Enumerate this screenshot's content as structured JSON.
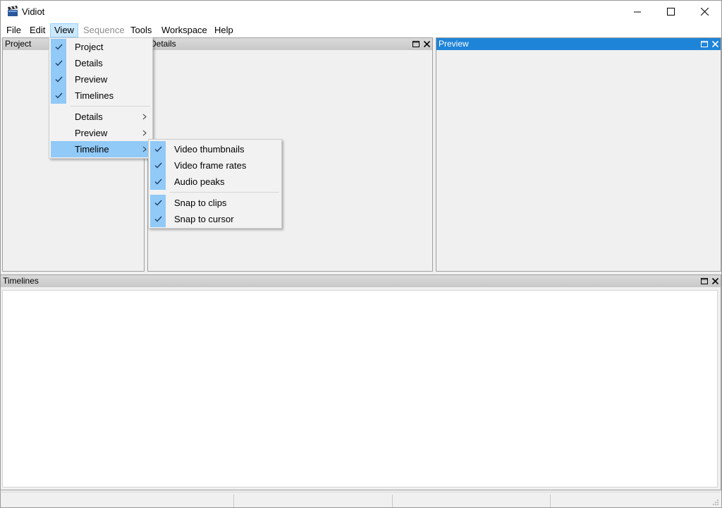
{
  "window": {
    "title": "Vidiot"
  },
  "menubar": {
    "items": [
      {
        "label": "File"
      },
      {
        "label": "Edit"
      },
      {
        "label": "View"
      },
      {
        "label": "Sequence"
      },
      {
        "label": "Tools"
      },
      {
        "label": "Workspace"
      },
      {
        "label": "Help"
      }
    ]
  },
  "panes": {
    "project": {
      "title": "Project"
    },
    "details": {
      "title": "Details"
    },
    "preview": {
      "title": "Preview"
    },
    "timelines": {
      "title": "Timelines"
    }
  },
  "view_menu": {
    "items": [
      {
        "label": "Project",
        "checked": true
      },
      {
        "label": "Details",
        "checked": true
      },
      {
        "label": "Preview",
        "checked": true
      },
      {
        "label": "Timelines",
        "checked": true
      },
      {
        "label": "Details",
        "submenu": true
      },
      {
        "label": "Preview",
        "submenu": true
      },
      {
        "label": "Timeline",
        "submenu": true,
        "highlighted": true
      }
    ]
  },
  "timeline_submenu": {
    "items": [
      {
        "label": "Video thumbnails",
        "checked": true
      },
      {
        "label": "Video frame rates",
        "checked": true
      },
      {
        "label": "Audio peaks",
        "checked": true
      },
      {
        "label": "Snap to clips",
        "checked": true
      },
      {
        "label": "Snap to cursor",
        "checked": true
      }
    ]
  },
  "colors": {
    "menu_highlight": "#91c9f7",
    "active_caption": "#1e84d8",
    "menubar_active": "#cce8ff"
  },
  "icons": {
    "app": "clapperboard-icon",
    "check": "checkmark-icon",
    "submenu": "chevron-right-icon",
    "pane_float": "maximize-pane-icon",
    "pane_close": "close-icon"
  }
}
